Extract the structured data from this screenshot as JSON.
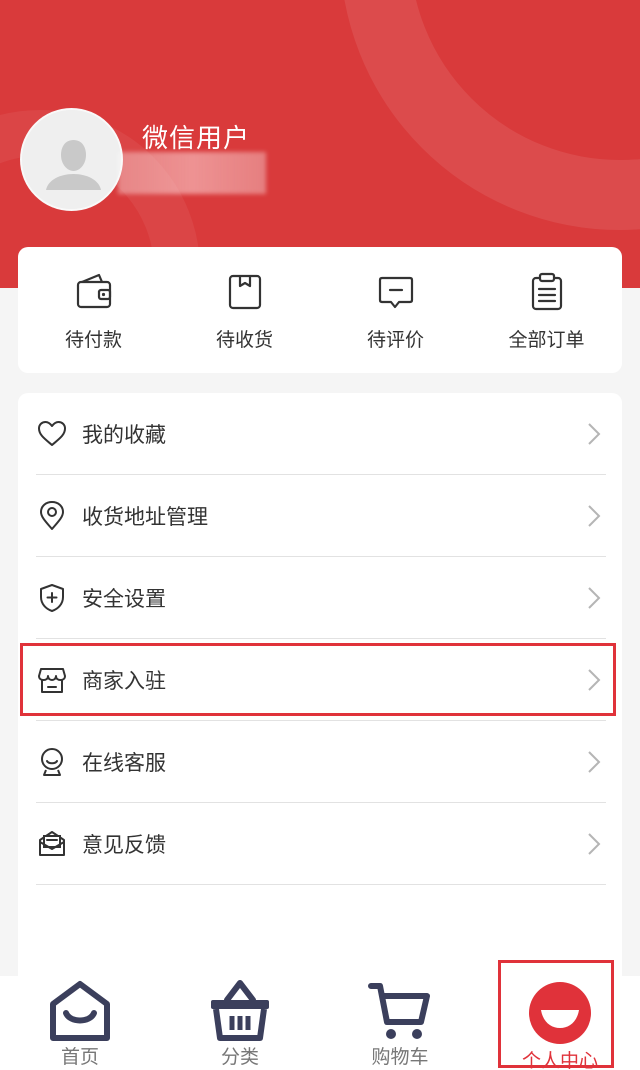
{
  "profile": {
    "nickname": "微信用户"
  },
  "orders": [
    {
      "label": "待付款",
      "icon": "wallet-icon"
    },
    {
      "label": "待收货",
      "icon": "package-icon"
    },
    {
      "label": "待评价",
      "icon": "comment-icon"
    },
    {
      "label": "全部订单",
      "icon": "clipboard-icon"
    }
  ],
  "menu": [
    {
      "label": "我的收藏",
      "icon": "heart-icon"
    },
    {
      "label": "收货地址管理",
      "icon": "location-pin-icon"
    },
    {
      "label": "安全设置",
      "icon": "shield-icon"
    },
    {
      "label": "商家入驻",
      "icon": "store-icon"
    },
    {
      "label": "在线客服",
      "icon": "customer-service-icon"
    },
    {
      "label": "意见反馈",
      "icon": "feedback-icon"
    }
  ],
  "tabs": [
    {
      "label": "首页",
      "icon": "home-icon"
    },
    {
      "label": "分类",
      "icon": "basket-icon"
    },
    {
      "label": "购物车",
      "icon": "cart-icon"
    },
    {
      "label": "个人中心",
      "icon": "profile-icon"
    }
  ],
  "colors": {
    "brand": "#d93a3b",
    "highlight": "#e0323a",
    "icon": "#333333",
    "tab_icon": "#3b3f5c"
  }
}
